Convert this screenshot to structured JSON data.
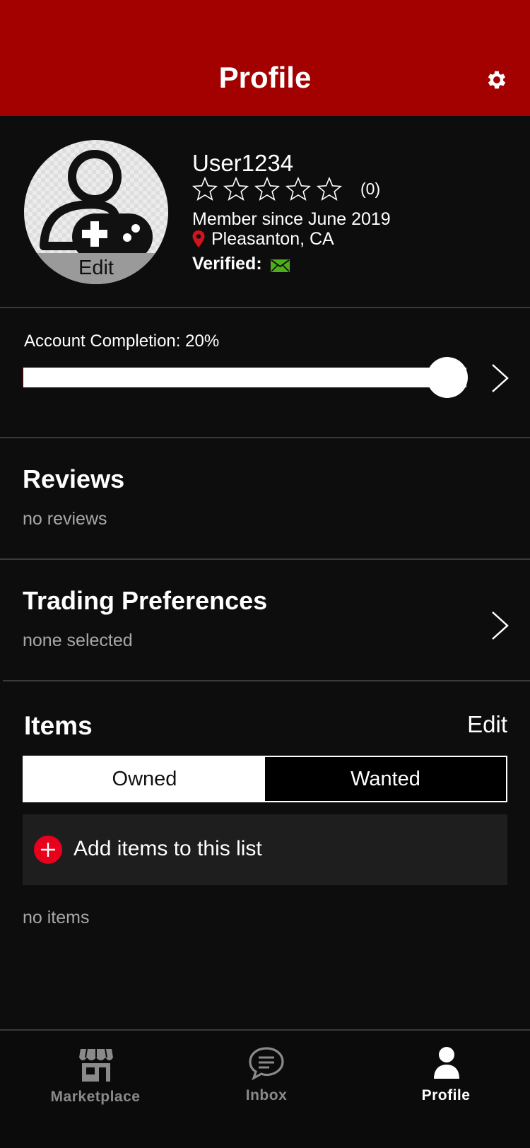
{
  "header": {
    "title": "Profile",
    "settings_icon": "gear-icon"
  },
  "profile": {
    "avatar_icon": "user-gamepad-icon",
    "avatar_edit_label": "Edit",
    "username": "User1234",
    "rating": {
      "stars_filled": 0,
      "stars_total": 5,
      "count_label": "(0)"
    },
    "member_since": "Member since June 2019",
    "location_icon": "location-pin-icon",
    "location": "Pleasanton, CA",
    "verified_label": "Verified:",
    "verified_icon": "mail-icon",
    "verified_icon_color": "#4caf1a"
  },
  "completion": {
    "label": "Account Completion: 20%",
    "percent": 20,
    "fill_color": "#7a0000"
  },
  "reviews": {
    "title": "Reviews",
    "subtitle": "no reviews"
  },
  "trading": {
    "title": "Trading Preferences",
    "subtitle": "none selected"
  },
  "items": {
    "title": "Items",
    "edit_label": "Edit",
    "tabs": [
      {
        "label": "Owned",
        "active": true
      },
      {
        "label": "Wanted",
        "active": false
      }
    ],
    "add_label": "Add items to this list",
    "add_icon": "plus-circle-icon",
    "empty_label": "no items"
  },
  "tabbar": {
    "tabs": [
      {
        "label": "Marketplace",
        "icon": "storefront-icon",
        "active": false
      },
      {
        "label": "Inbox",
        "icon": "chat-bubble-icon",
        "active": false
      },
      {
        "label": "Profile",
        "icon": "user-icon",
        "active": true
      }
    ]
  },
  "colors": {
    "header_bg": "#a30000",
    "accent_red": "#e8001c",
    "background": "#0d0d0d"
  }
}
